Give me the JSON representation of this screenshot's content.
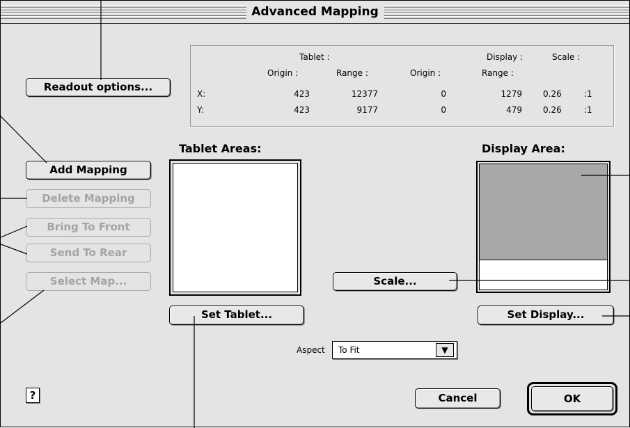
{
  "window": {
    "title": "Advanced Mapping"
  },
  "buttons": {
    "readout_options": "Readout options...",
    "add_mapping": "Add Mapping",
    "delete_mapping": "Delete Mapping",
    "bring_to_front": "Bring To Front",
    "send_to_rear": "Send To Rear",
    "select_map": "Select Map...",
    "scale": "Scale...",
    "set_tablet": "Set Tablet...",
    "set_display": "Set Display...",
    "cancel": "Cancel",
    "ok": "OK",
    "help": "?"
  },
  "readout": {
    "tablet": "Tablet :",
    "display": "Display :",
    "scale": "Scale :",
    "origin": "Origin :",
    "range": "Range :",
    "rows": [
      {
        "axis": "X:",
        "tablet_origin": "423",
        "tablet_range": "12377",
        "display_origin": "0",
        "display_range": "1279",
        "scale": "0.26",
        "ratio": ":1"
      },
      {
        "axis": "Y:",
        "tablet_origin": "423",
        "tablet_range": "9177",
        "display_origin": "0",
        "display_range": "479",
        "scale": "0.26",
        "ratio": ":1"
      }
    ]
  },
  "labels": {
    "tablet_areas": "Tablet Areas:",
    "display_area": "Display Area:",
    "aspect": "Aspect"
  },
  "aspect": {
    "selected": "To Fit",
    "arrow_icon": "▼"
  },
  "colors": {
    "display_map_fill": "#a8a8a8",
    "window_bg": "#e4e4e4",
    "disabled_text": "#a4a4a4"
  }
}
